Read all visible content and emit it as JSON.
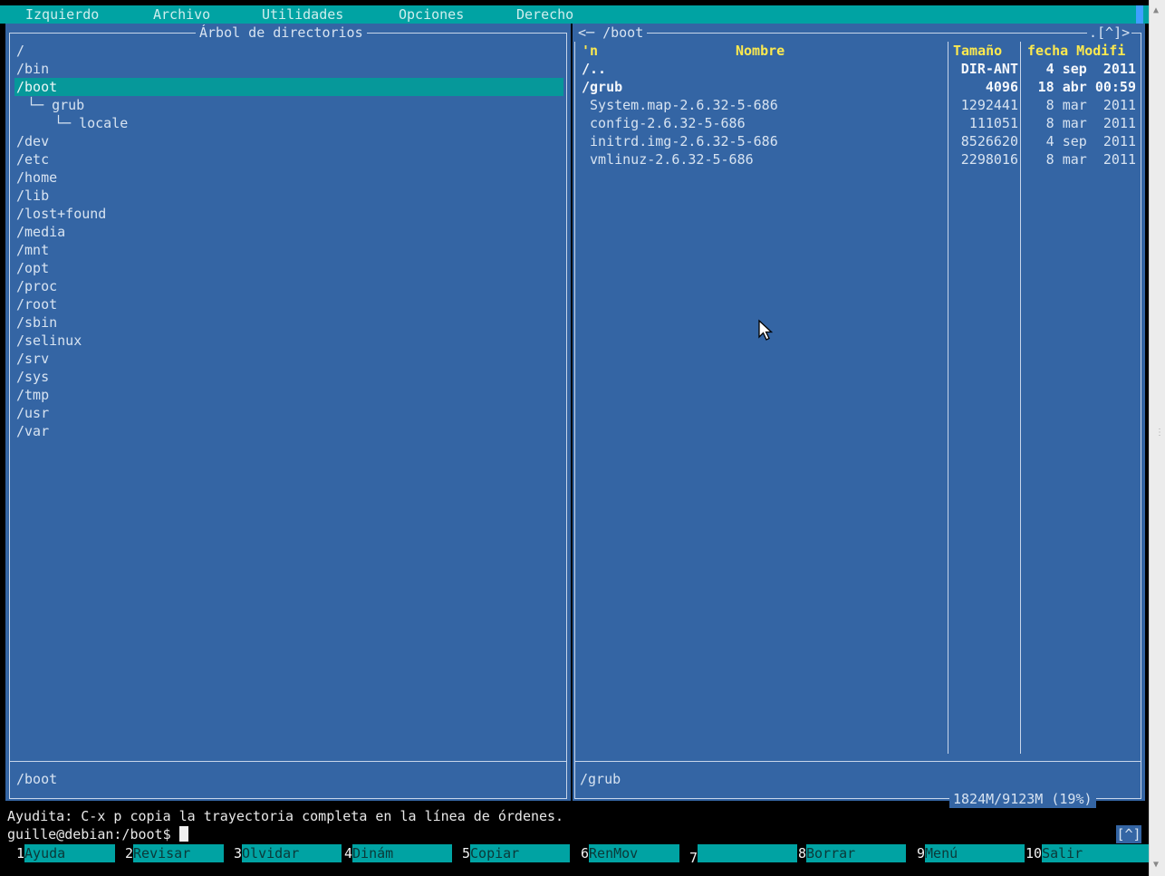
{
  "menu": {
    "items": [
      "Izquierdo",
      "Archivo",
      "Utilidades",
      "Opciones",
      "Derecho"
    ]
  },
  "left_panel": {
    "title": "Árbol de directorios",
    "items": [
      "/",
      "/bin",
      "/boot",
      "└─ grub",
      "└─ locale",
      "/dev",
      "/etc",
      "/home",
      "/lib",
      "/lost+found",
      "/media",
      "/mnt",
      "/opt",
      "/proc",
      "/root",
      "/sbin",
      "/selinux",
      "/srv",
      "/sys",
      "/tmp",
      "/usr",
      "/var"
    ],
    "selected": "/boot",
    "status": "/boot"
  },
  "right_panel": {
    "title": "/boot",
    "nav_left": "<─",
    "nav_right": ".[^]>",
    "columns": {
      "sort": "'n",
      "name": "Nombre",
      "size": "Tamaño",
      "date": "fecha Modifi"
    },
    "files": [
      {
        "name": "/..",
        "size": "DIR-ANT",
        "date": "4 sep  2011",
        "bold": true
      },
      {
        "name": "/grub",
        "size": "4096",
        "date": "18 abr 00:59",
        "bold": true
      },
      {
        "name": " System.map-2.6.32-5-686",
        "size": "1292441",
        "date": " 8 mar  2011",
        "bold": false
      },
      {
        "name": " config-2.6.32-5-686",
        "size": "111051",
        "date": " 8 mar  2011",
        "bold": false
      },
      {
        "name": " initrd.img-2.6.32-5-686",
        "size": "8526620",
        "date": " 4 sep  2011",
        "bold": false
      },
      {
        "name": " vmlinuz-2.6.32-5-686",
        "size": "2298016",
        "date": " 8 mar  2011",
        "bold": false
      }
    ],
    "status": "/grub",
    "disk": "1824M/9123M (19%)"
  },
  "hint": "Ayudita: C-x p copia la trayectoria completa en la línea de órdenes.",
  "prompt": "guille@debian:/boot$ ",
  "history_button": "[^]",
  "fkeys": [
    {
      "num": "1",
      "label": "Ayuda"
    },
    {
      "num": "2",
      "label": "Revisar"
    },
    {
      "num": "3",
      "label": "Olvidar"
    },
    {
      "num": "4",
      "label": "Dinám"
    },
    {
      "num": "5",
      "label": "Copiar"
    },
    {
      "num": "6",
      "label": "RenMov"
    },
    {
      "num": "7",
      "label": ""
    },
    {
      "num": "8",
      "label": "Borrar"
    },
    {
      "num": "9",
      "label": "Menú"
    },
    {
      "num": "10",
      "label": "Salir"
    }
  ],
  "colors": {
    "panel_bg": "#3465a4",
    "bar_cyan": "#00a3a3",
    "header_yellow": "#fce94f",
    "selection": "#06989a"
  }
}
